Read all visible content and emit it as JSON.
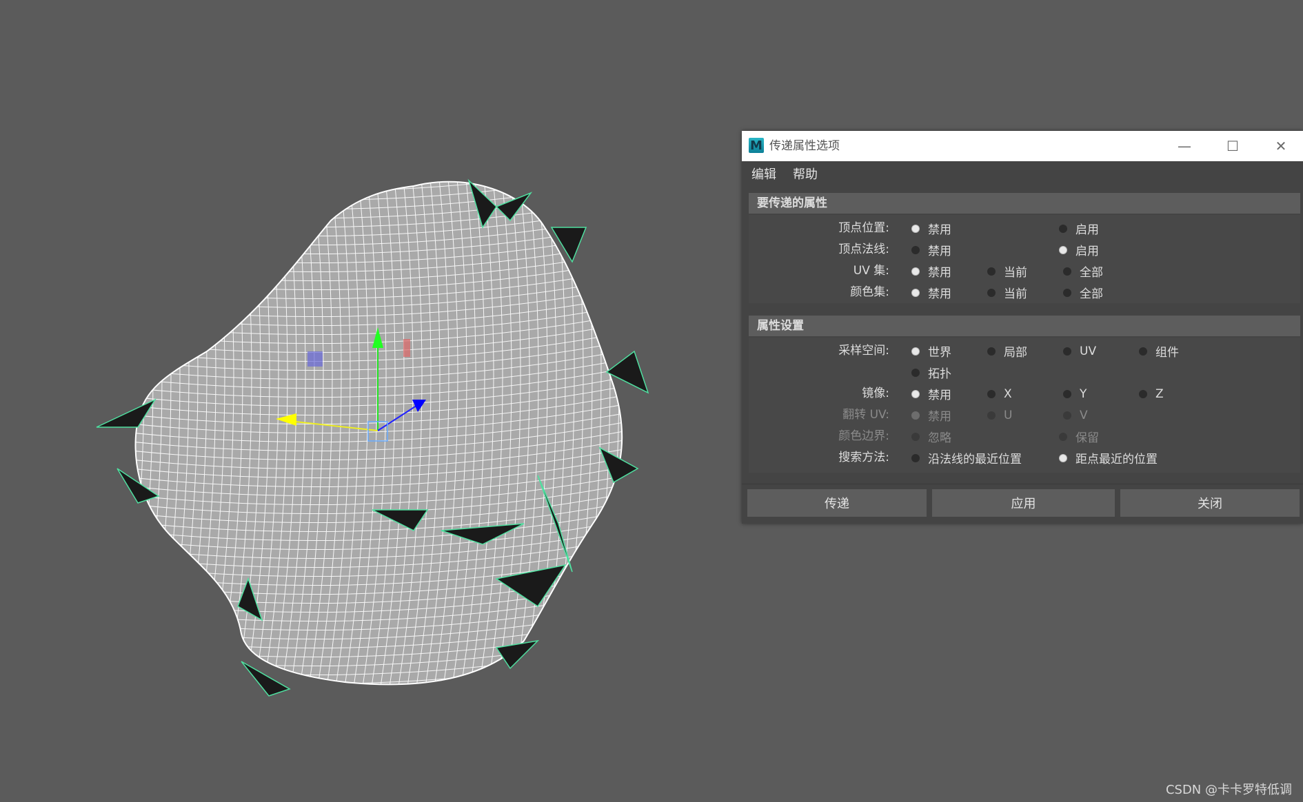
{
  "dialog": {
    "title": "传递属性选项",
    "app_icon": "M",
    "window_controls": {
      "minimize": "—",
      "maximize": "☐",
      "close": "✕"
    },
    "menu": [
      "编辑",
      "帮助"
    ],
    "sections": {
      "transfer": {
        "header": "要传递的属性",
        "rows": [
          {
            "label": "顶点位置:",
            "options": [
              "禁用",
              "启用"
            ],
            "selected": 0
          },
          {
            "label": "顶点法线:",
            "options": [
              "禁用",
              "启用"
            ],
            "selected": 1
          },
          {
            "label": "UV 集:",
            "options": [
              "禁用",
              "当前",
              "全部"
            ],
            "selected": 0
          },
          {
            "label": "颜色集:",
            "options": [
              "禁用",
              "当前",
              "全部"
            ],
            "selected": 0
          }
        ]
      },
      "settings": {
        "header": "属性设置",
        "rows": [
          {
            "label": "采样空间:",
            "options": [
              "世界",
              "局部",
              "UV",
              "组件"
            ],
            "selected": 0
          },
          {
            "label": "",
            "options": [
              "拓扑"
            ],
            "selected": -1
          },
          {
            "label": "镜像:",
            "options": [
              "禁用",
              "X",
              "Y",
              "Z"
            ],
            "selected": 0
          },
          {
            "label": "翻转 UV:",
            "options": [
              "禁用",
              "U",
              "V"
            ],
            "selected": 0,
            "disabled": true
          },
          {
            "label": "颜色边界:",
            "options": [
              "忽略",
              "保留"
            ],
            "selected": -1,
            "disabled": true
          },
          {
            "label": "搜索方法:",
            "options": [
              "沿法线的最近位置",
              "距点最近的位置"
            ],
            "selected": 1
          }
        ]
      }
    },
    "buttons": {
      "transfer": "传递",
      "apply": "应用",
      "close": "关闭"
    }
  },
  "watermark": "CSDN @卡卡罗特低调",
  "viewport": {
    "background": "#5b5b5b",
    "wire_color": "#ffffff",
    "selection_color": "#4fe0a0"
  }
}
